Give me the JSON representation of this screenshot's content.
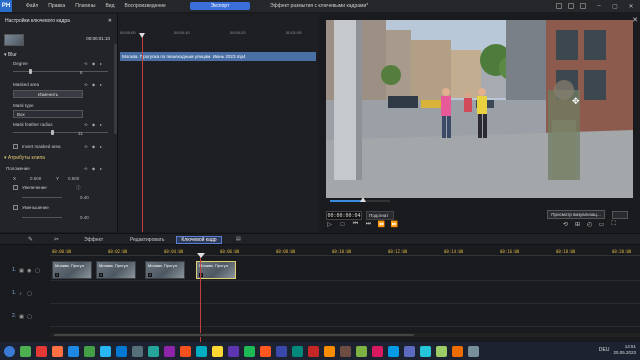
{
  "app": {
    "logo": "PH",
    "menu": [
      "Файл",
      "Правка",
      "Плагины",
      "Вид",
      "Воспроизведение"
    ],
    "export_label": "Экспорт",
    "document_title": "Эффект размытия с ключевыми кадрами*",
    "window_controls": [
      "–",
      "▢",
      "✕"
    ]
  },
  "keyframe_panel": {
    "title": "Настройки ключевого кадра",
    "close": "✕",
    "timecode": "00:00:01:10",
    "blur_group": "Blur",
    "degree_label": "Degree",
    "degree_value": "6",
    "degree_level": 0.18,
    "masked_area_label": "Masked area",
    "change_button": "Изменить",
    "mask_type_label": "Mask type",
    "mask_type_value": "Box",
    "mask_feather_label": "Mask feather radius",
    "mask_feather_value": "31",
    "mask_feather_level": 0.42,
    "invert_label": "Invert masked area",
    "clip_attributes": "Атрибуты клипа",
    "position_label": "Положение",
    "x_label": "X",
    "x_value": "0.500",
    "y_label": "Y",
    "y_value": "0.500",
    "scale_label": "Увеличение",
    "scale_value": "0.40",
    "shrink_label": "Уменьшение",
    "shrink_value": "0.40"
  },
  "keyframe_ruler": [
    "00:00:00",
    "00:00:10",
    "00:00:20",
    "00:01:05"
  ],
  "keyframe_clip": "Москва. Прогулка по пешеходным улицам. Июнь 2023.mp4",
  "preview": {
    "timecode": "00:00:00:04",
    "fit": "Подогнат",
    "view_button": "Просмотр визуализац...",
    "transport": [
      "▷",
      "□",
      "⏮",
      "⏭",
      "⏪",
      "⏩"
    ],
    "right_icons": [
      "⟲",
      "⊞",
      "◴",
      "▭",
      "⛶"
    ]
  },
  "tabs": {
    "effect": "Эффект",
    "edit": "Редактировать",
    "keyframe": "Ключевой кадр"
  },
  "timeline": {
    "ruler": [
      "00:00:00",
      "00:02:00",
      "00:04:00",
      "00:06:00",
      "00:08:00",
      "00:10:00",
      "00:12:00",
      "00:14:00",
      "00:16:00",
      "00:18:00",
      "00:20:00"
    ],
    "tracks": [
      "1.",
      "1.",
      "2."
    ],
    "clip_label": "Москва. Прогул",
    "clip_marker": "i"
  },
  "taskbar": {
    "lang": "DEU",
    "time": "14:51",
    "date": "20.05.2023",
    "icon_colors": [
      "#3a7bd5",
      "#4caf50",
      "#e53935",
      "#ff7043",
      "#1e88e5",
      "#43a047",
      "#29b6f6",
      "#0078d4",
      "#546e7a",
      "#26a69a",
      "#8e24aa",
      "#f4511e",
      "#00acc1",
      "#fdd835",
      "#5e35b1",
      "#1db954",
      "#ff5722",
      "#3949ab",
      "#00897b",
      "#c62828",
      "#fb8c00",
      "#6d4c41",
      "#7cb342",
      "#d81b60",
      "#039be5",
      "#5c6bc0",
      "#26c6da",
      "#9ccc65",
      "#ef6c00",
      "#78909c"
    ]
  }
}
